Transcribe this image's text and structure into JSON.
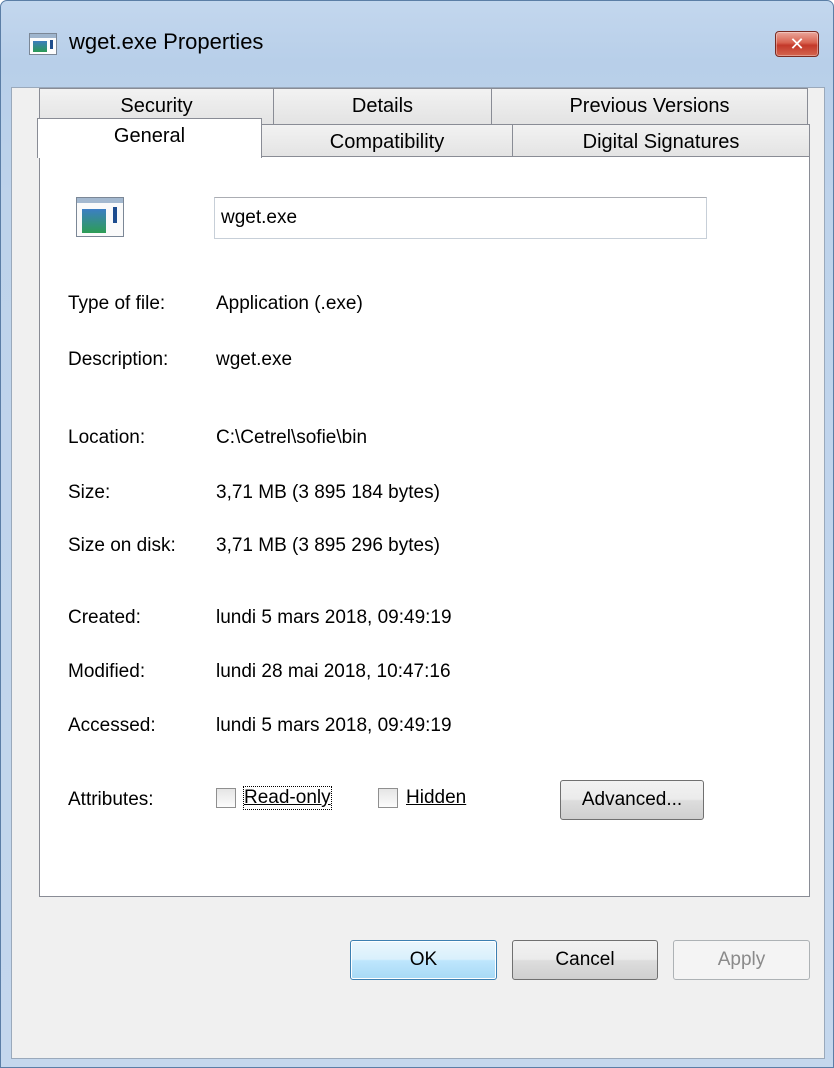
{
  "window": {
    "title": "wget.exe Properties",
    "close_glyph": "✕",
    "icon": "application-icon"
  },
  "tabs": {
    "row1": [
      {
        "label": "Security"
      },
      {
        "label": "Details"
      },
      {
        "label": "Previous Versions"
      }
    ],
    "row2": [
      {
        "label": "General",
        "active": true
      },
      {
        "label": "Compatibility"
      },
      {
        "label": "Digital Signatures"
      }
    ]
  },
  "general": {
    "filename": "wget.exe",
    "type_label": "Type of file:",
    "type_value": "Application (.exe)",
    "description_label": "Description:",
    "description_value": "wget.exe",
    "location_label": "Location:",
    "location_value": "C:\\Cetrel\\sofie\\bin",
    "size_label": "Size:",
    "size_value": "3,71 MB (3 895 184 bytes)",
    "size_on_disk_label": "Size on disk:",
    "size_on_disk_value": "3,71 MB (3 895 296 bytes)",
    "created_label": "Created:",
    "created_value": "lundi 5 mars 2018, 09:49:19",
    "modified_label": "Modified:",
    "modified_value": "lundi 28 mai 2018, 10:47:16",
    "accessed_label": "Accessed:",
    "accessed_value": "lundi 5 mars 2018, 09:49:19",
    "attributes_label": "Attributes:",
    "readonly_label": "Read-only",
    "readonly_checked": false,
    "hidden_label": "Hidden",
    "hidden_checked": false,
    "advanced_label": "Advanced..."
  },
  "buttons": {
    "ok": "OK",
    "cancel": "Cancel",
    "apply": "Apply"
  },
  "colors": {
    "accent": "#3c7fb1",
    "close": "#c3392a",
    "frame": "#bed3eb"
  }
}
